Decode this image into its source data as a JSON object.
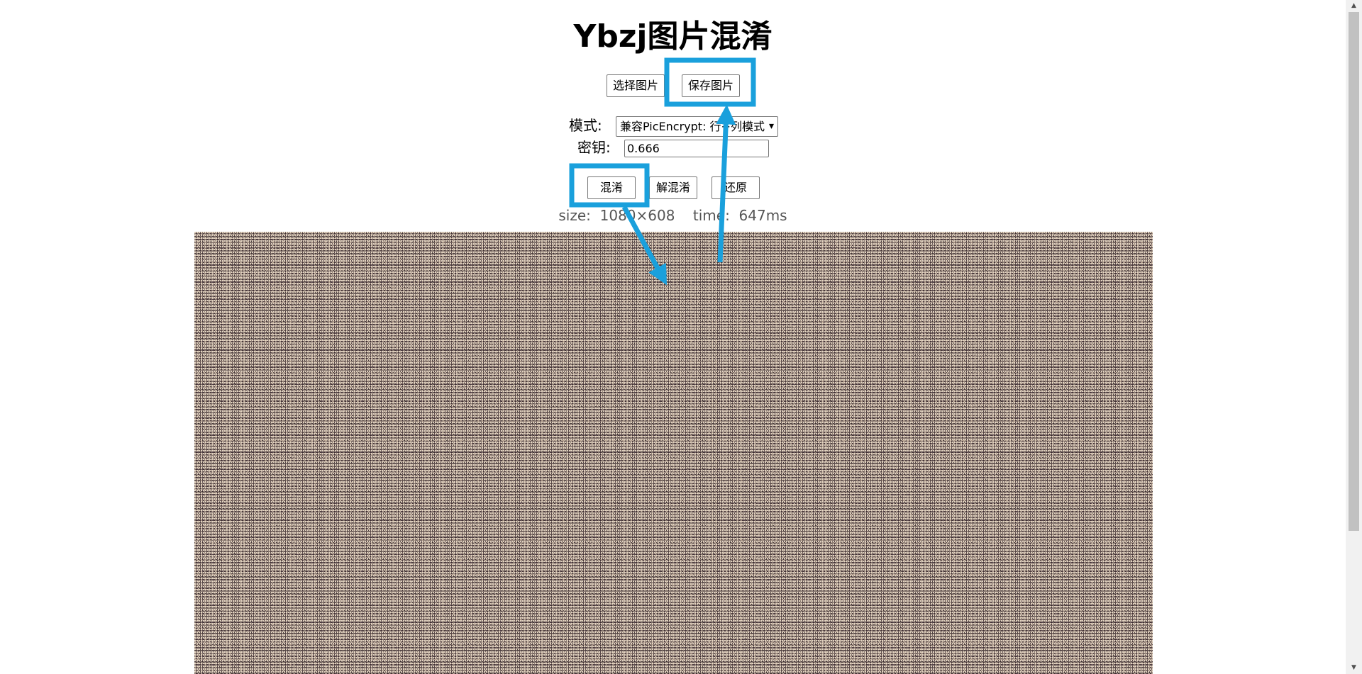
{
  "page": {
    "title": "Ybzj图片混淆"
  },
  "toolbar": {
    "select_label": "选择图片",
    "save_label": "保存图片"
  },
  "settings": {
    "mode_label": "模式:",
    "mode_value": "兼容PicEncrypt: 行+列模式",
    "key_label": "密钥:",
    "key_value": "0.666"
  },
  "actions": {
    "mix_label": "混淆",
    "unmix_label": "解混淆",
    "restore_label": "还原"
  },
  "info": {
    "text": "size:  1080×608    time:  647ms"
  },
  "annotation": {
    "highlight_color": "#1aa0dc"
  }
}
